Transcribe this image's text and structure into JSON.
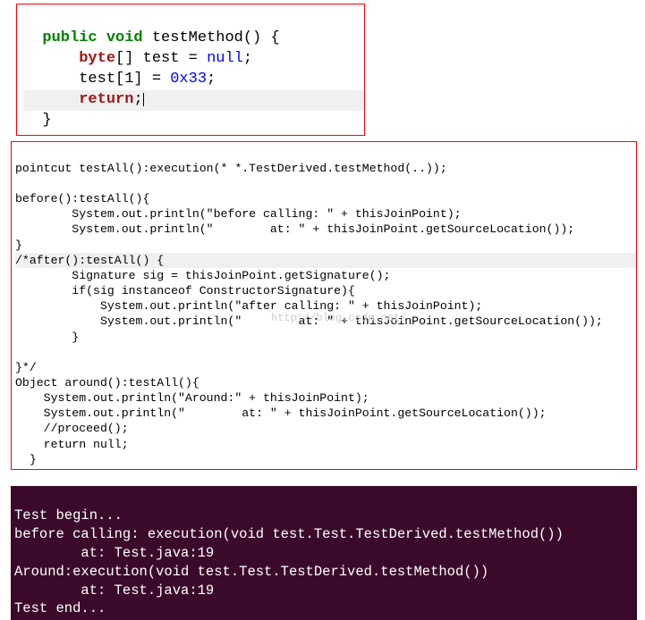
{
  "block1": {
    "l1_p1": "  ",
    "l1_kw1": "public",
    "l1_sp1": " ",
    "l1_kw2": "void",
    "l1_p2": " testMethod() {",
    "l2_p1": "      ",
    "l2_kw1": "byte",
    "l2_p2": "[] test = ",
    "l2_kw2": "null",
    "l2_p3": ";",
    "l3_p1": "      test[",
    "l3_n1": "1",
    "l3_p2": "] = ",
    "l3_n2": "0x33",
    "l3_p3": ";",
    "l4_p1": "      ",
    "l4_kw1": "return",
    "l4_p2": ";",
    "l5": "  }"
  },
  "block2": {
    "l1": "pointcut testAll():execution(* *.TestDerived.testMethod(..));",
    "l2": "",
    "l3": "before():testAll(){",
    "l4": "        System.out.println(\"before calling: \" + thisJoinPoint);",
    "l5": "        System.out.println(\"        at: \" + thisJoinPoint.getSourceLocation());",
    "l6": "}",
    "l7": "/*after():testAll() {",
    "l8": "        Signature sig = thisJoinPoint.getSignature();",
    "l9": "        if(sig instanceof ConstructorSignature){",
    "l10": "            System.out.println(\"after calling: \" + thisJoinPoint);",
    "l11": "            System.out.println(\"        at: \" + thisJoinPoint.getSourceLocation());",
    "l12": "        }",
    "l13": "",
    "l14": "}*/",
    "l15": "Object around():testAll(){",
    "l16": "    System.out.println(\"Around:\" + thisJoinPoint);",
    "l17": "    System.out.println(\"        at: \" + thisJoinPoint.getSourceLocation());",
    "l18": "    //proceed();",
    "l19": "    return null;",
    "l20": "  }",
    "watermark": "http://blog.csdn.net/"
  },
  "block3": {
    "l1": "Test begin...",
    "l2": "before calling: execution(void test.Test.TestDerived.testMethod())",
    "l3": "        at: Test.java:19",
    "l4": "Around:execution(void test.Test.TestDerived.testMethod())",
    "l5": "        at: Test.java:19",
    "l6": "Test end..."
  }
}
